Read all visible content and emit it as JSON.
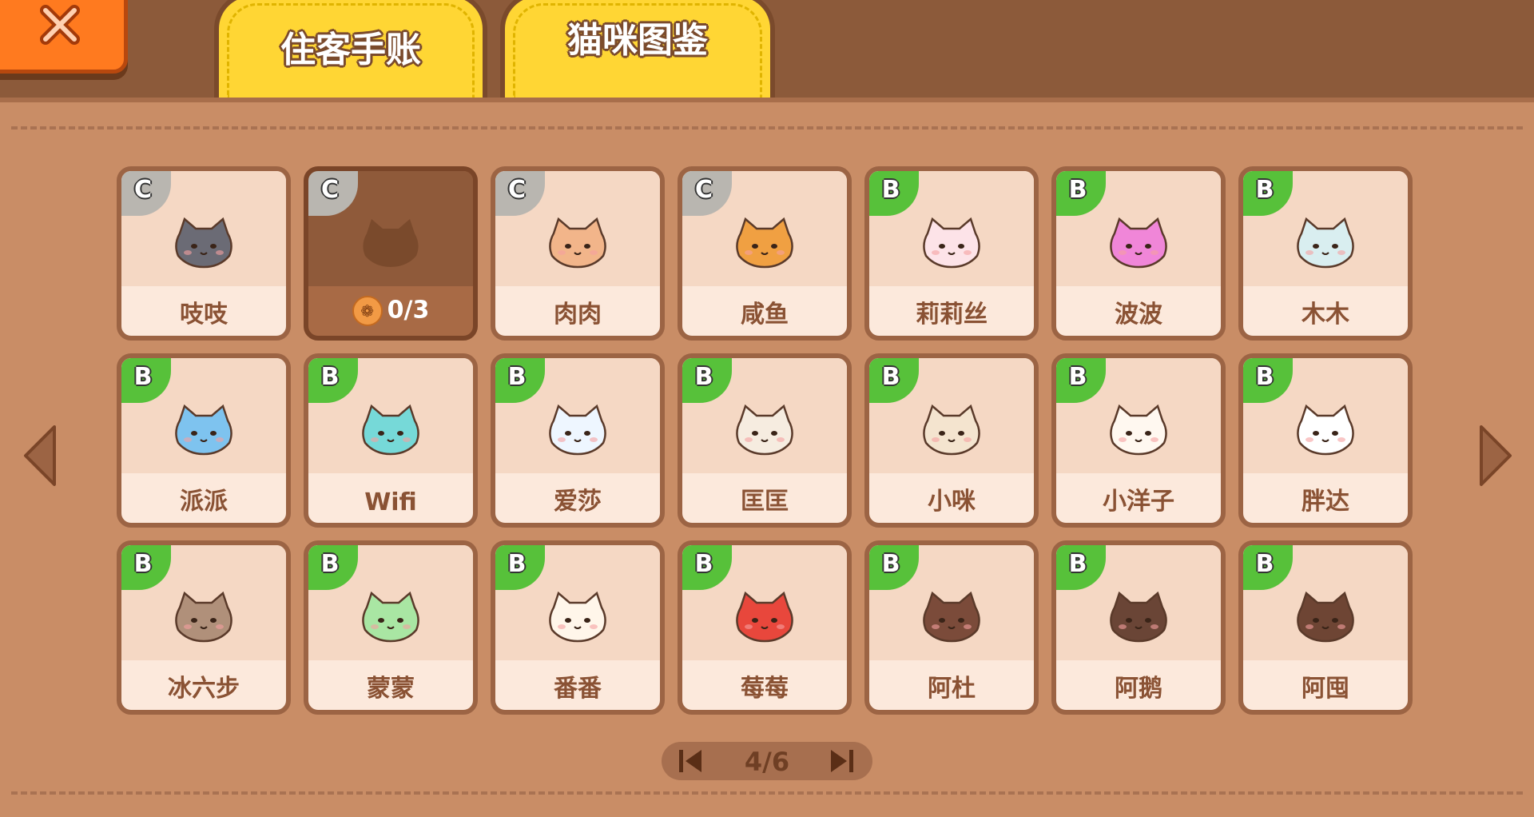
{
  "tabs": [
    {
      "label": "住客手账"
    },
    {
      "label": "猫咪图鉴"
    }
  ],
  "colors": {
    "rank_c": "#b9b6b0",
    "rank_b": "#57c13a",
    "accent_close": "#ff7a1f",
    "tab": "#ffd634"
  },
  "cats": [
    {
      "rank": "C",
      "name": "吱吱",
      "color": "#6b6b75",
      "locked": false
    },
    {
      "rank": "C",
      "name": "",
      "progress": "0/3",
      "color": "#7a4a2c",
      "locked": true
    },
    {
      "rank": "C",
      "name": "肉肉",
      "color": "#f2b58a",
      "locked": false
    },
    {
      "rank": "C",
      "name": "咸鱼",
      "color": "#f0a042",
      "locked": false
    },
    {
      "rank": "B",
      "name": "莉莉丝",
      "color": "#fde3e8",
      "locked": false
    },
    {
      "rank": "B",
      "name": "波波",
      "color": "#f086d8",
      "locked": false
    },
    {
      "rank": "B",
      "name": "木木",
      "color": "#d9eef0",
      "locked": false
    },
    {
      "rank": "B",
      "name": "派派",
      "color": "#7ec3ef",
      "locked": false
    },
    {
      "rank": "B",
      "name": "Wifi",
      "color": "#76d9d8",
      "locked": false
    },
    {
      "rank": "B",
      "name": "爱莎",
      "color": "#eef6ff",
      "locked": false
    },
    {
      "rank": "B",
      "name": "匡匡",
      "color": "#f6ece0",
      "locked": false
    },
    {
      "rank": "B",
      "name": "小咪",
      "color": "#f4e4cf",
      "locked": false
    },
    {
      "rank": "B",
      "name": "小洋子",
      "color": "#fff8f0",
      "locked": false
    },
    {
      "rank": "B",
      "name": "胖达",
      "color": "#ffffff",
      "locked": false
    },
    {
      "rank": "B",
      "name": "冰六步",
      "color": "#b0907a",
      "locked": false
    },
    {
      "rank": "B",
      "name": "蒙蒙",
      "color": "#a9e6a3",
      "locked": false
    },
    {
      "rank": "B",
      "name": "番番",
      "color": "#fff6ea",
      "locked": false
    },
    {
      "rank": "B",
      "name": "莓莓",
      "color": "#e8473c",
      "locked": false
    },
    {
      "rank": "B",
      "name": "阿杜",
      "color": "#7b4b3a",
      "locked": false
    },
    {
      "rank": "B",
      "name": "阿鹅",
      "color": "#6a4536",
      "locked": false
    },
    {
      "rank": "B",
      "name": "阿囤",
      "color": "#6e4534",
      "locked": false
    }
  ],
  "pager": {
    "text": "4/6",
    "current": 4,
    "total": 6
  },
  "icons": {
    "close": "close-x-icon",
    "prev": "triangle-left-icon",
    "next": "triangle-right-icon",
    "first": "skip-first-icon",
    "last": "skip-last-icon",
    "paw": "paw-icon"
  }
}
